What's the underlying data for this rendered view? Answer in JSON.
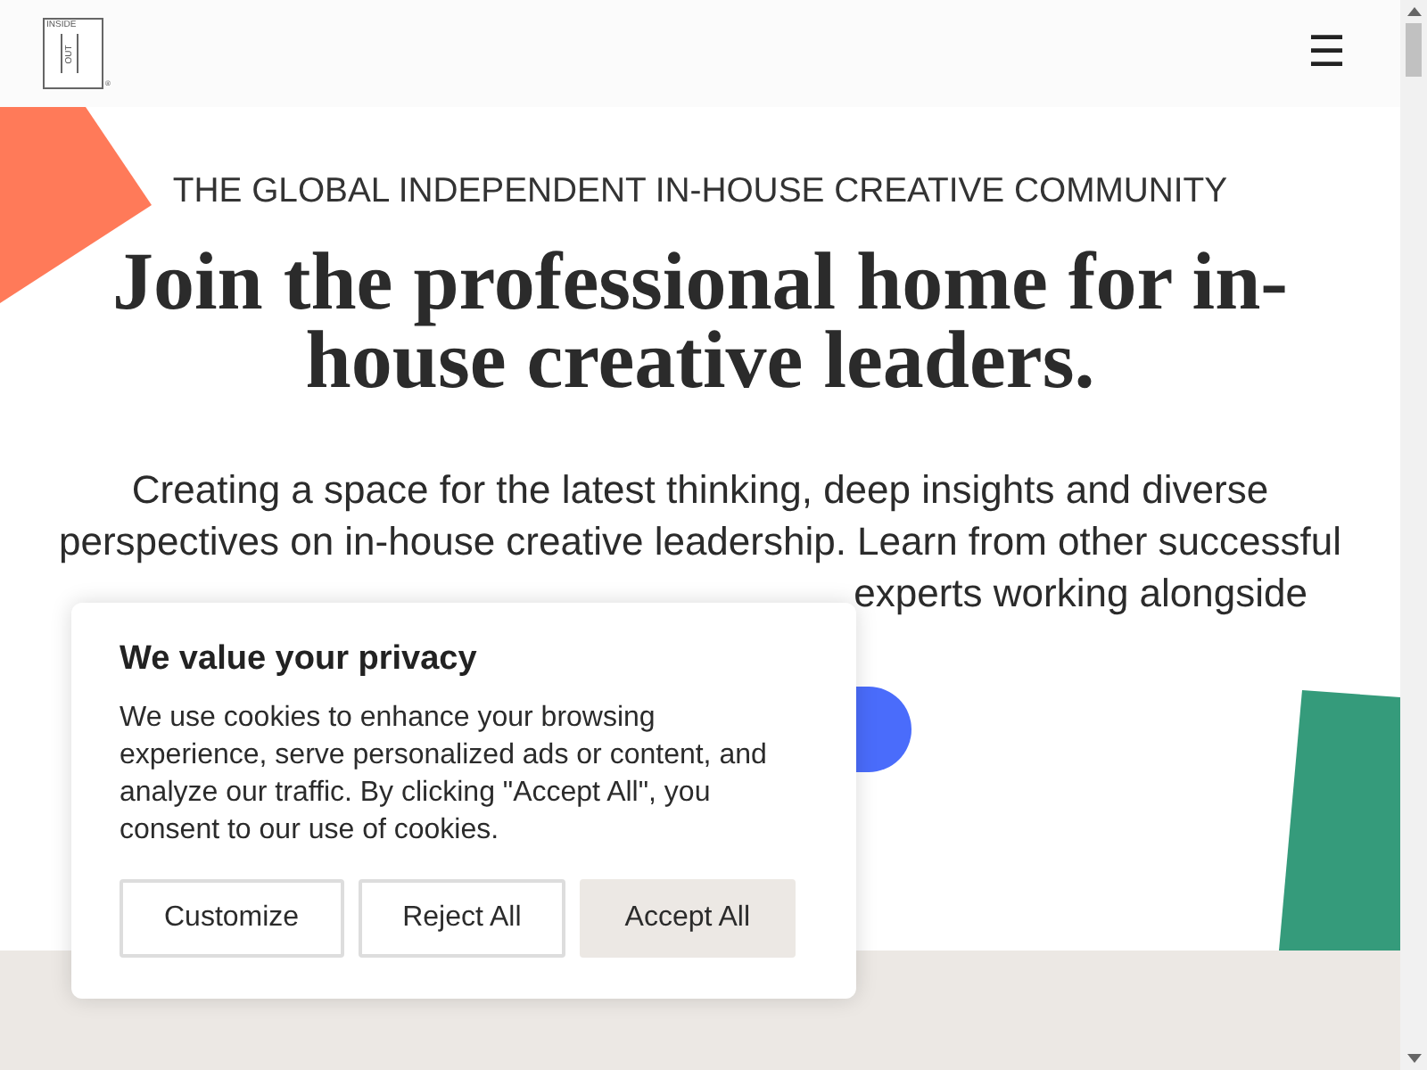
{
  "header": {
    "logo": {
      "top": "INSIDE",
      "side": "OUT",
      "mark": "®"
    },
    "menu_icon": "☰"
  },
  "hero": {
    "eyebrow": "THE GLOBAL INDEPENDENT IN-HOUSE CREATIVE COMMUNITY",
    "heading": "Join the professional home for in-house creative leaders.",
    "paragraph": "Creating a space for the latest thinking, deep insights and diverse perspectives on in-house creative leadership. Learn from other successful",
    "paragraph_visible_end": "experts working alongside"
  },
  "cookie_dialog": {
    "title": "We value your privacy",
    "body": "We use cookies to enhance your browsing experience, serve personalized ads or content, and analyze our traffic. By clicking \"Accept All\", you consent to our use of cookies.",
    "buttons": [
      {
        "label": "Customize",
        "kind": "outline"
      },
      {
        "label": "Reject All",
        "kind": "outline"
      },
      {
        "label": "Accept All",
        "kind": "filled"
      }
    ]
  }
}
